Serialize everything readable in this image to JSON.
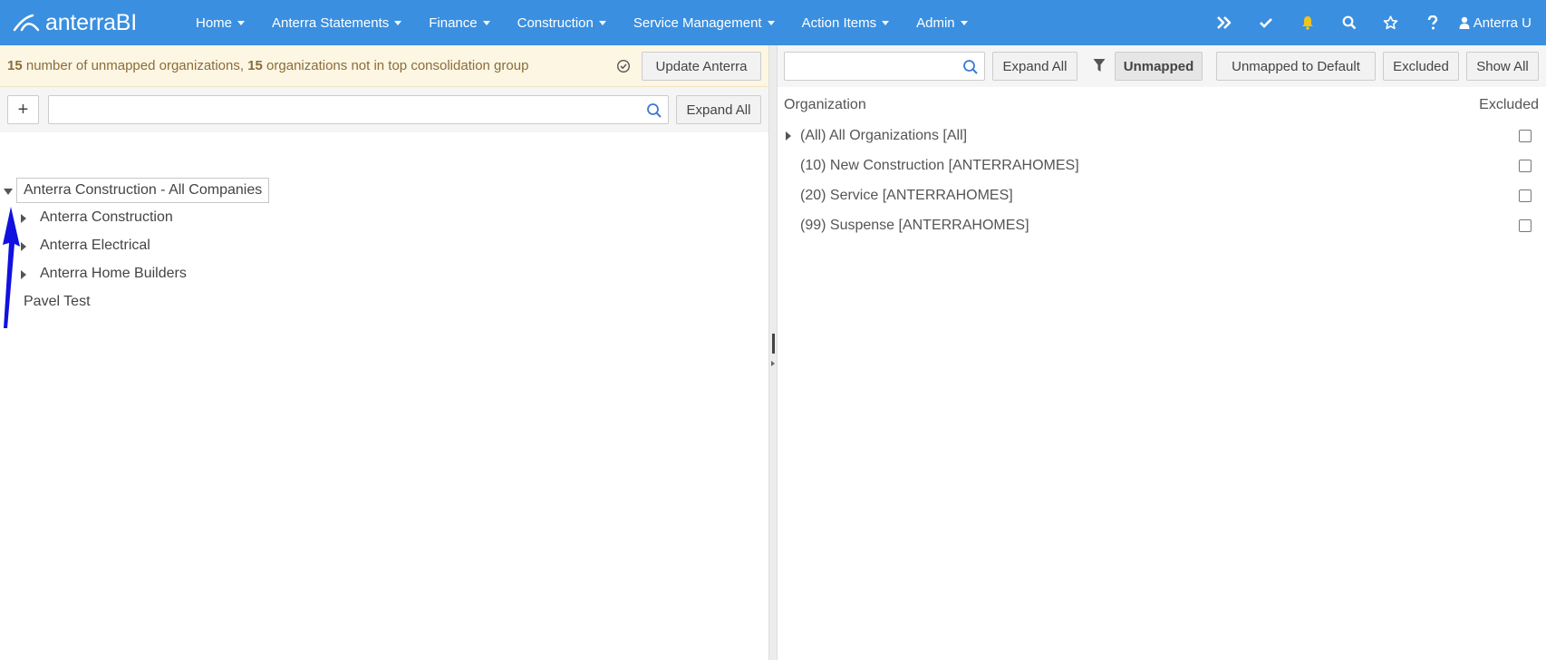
{
  "app": {
    "logo_text": "anterraBI",
    "user_label": "Anterra U"
  },
  "nav": [
    "Home",
    "Anterra Statements",
    "Finance",
    "Construction",
    "Service Management",
    "Action Items",
    "Admin"
  ],
  "nav_icons": [
    "double-chevron-right-icon",
    "checkmark-icon",
    "bell-icon",
    "search-icon",
    "star-icon",
    "question-icon"
  ],
  "colors": {
    "topbar": "#3a8fe0",
    "bell": "#f0c419",
    "banner_bg": "#fdf6e3",
    "arrow": "#1010e0"
  },
  "banner": {
    "count_unmapped": "15",
    "text_unmapped": "number of unmapped organizations,",
    "count_not_top": "15",
    "text_not_top": "organizations not in top consolidation group",
    "update_button": "Update Anterra"
  },
  "left_toolbar": {
    "add_button": "+",
    "search_placeholder": "",
    "expand_all": "Expand All"
  },
  "tree": {
    "root": "Anterra Construction - All Companies",
    "children": [
      "Anterra Construction",
      "Anterra Electrical",
      "Anterra Home Builders"
    ],
    "sibling": "Pavel Test"
  },
  "right_toolbar": {
    "search_placeholder": "",
    "expand_all": "Expand All",
    "unmapped": "Unmapped",
    "unmapped_to_default": "Unmapped to Default",
    "excluded": "Excluded",
    "show_all": "Show All"
  },
  "grid": {
    "col_org": "Organization",
    "col_excluded": "Excluded",
    "rows": [
      {
        "label": "(All) All Organizations [All]",
        "expandable": true
      },
      {
        "label": "(10) New Construction [ANTERRAHOMES]",
        "expandable": false
      },
      {
        "label": "(20) Service [ANTERRAHOMES]",
        "expandable": false
      },
      {
        "label": "(99) Suspense [ANTERRAHOMES]",
        "expandable": false
      }
    ]
  }
}
